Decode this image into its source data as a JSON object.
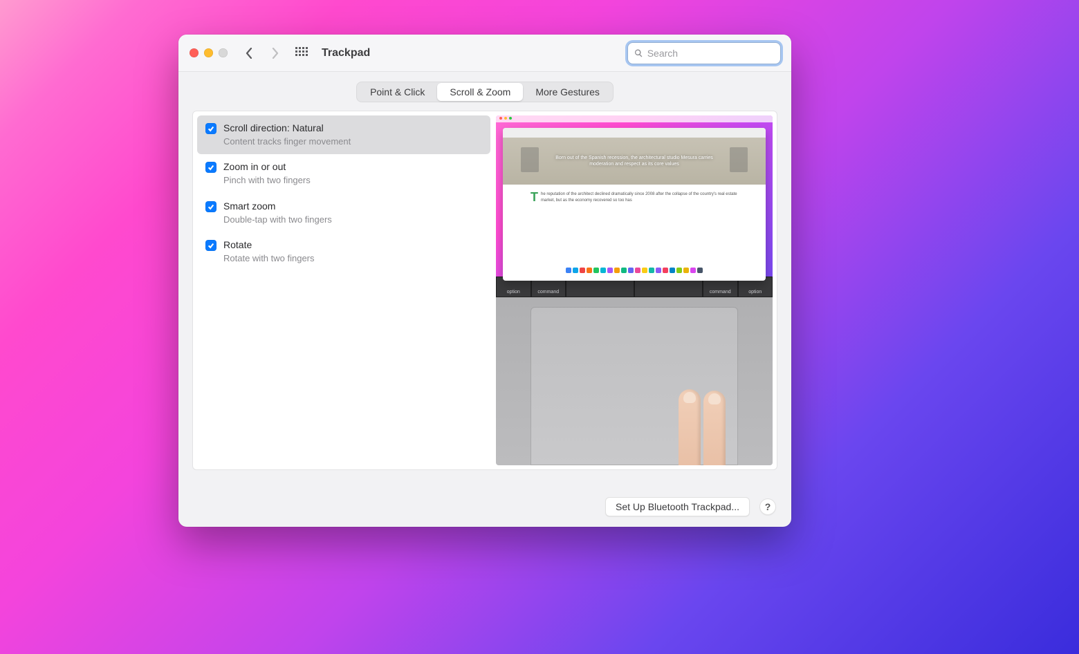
{
  "window": {
    "title": "Trackpad",
    "search_placeholder": "Search",
    "back_enabled": true,
    "forward_enabled": false
  },
  "tabs": [
    {
      "label": "Point & Click",
      "active": false
    },
    {
      "label": "Scroll & Zoom",
      "active": true
    },
    {
      "label": "More Gestures",
      "active": false
    }
  ],
  "options": [
    {
      "title": "Scroll direction: Natural",
      "subtitle": "Content tracks finger movement",
      "checked": true,
      "selected": true
    },
    {
      "title": "Zoom in or out",
      "subtitle": "Pinch with two fingers",
      "checked": true,
      "selected": false
    },
    {
      "title": "Smart zoom",
      "subtitle": "Double-tap with two fingers",
      "checked": true,
      "selected": false
    },
    {
      "title": "Rotate",
      "subtitle": "Rotate with two fingers",
      "checked": true,
      "selected": false
    }
  ],
  "preview": {
    "hero_text": "Born out of the Spanish recession, the architectural studio Mesura carries moderation and respect as its core values",
    "article_lead_letter": "T",
    "article_text": "he reputation of the architect declined dramatically since 2008 after the collapse of the country's real estate market, but as the economy recovered so too has",
    "touchbar_keys": [
      "option",
      "command",
      "",
      "",
      "command",
      "option"
    ]
  },
  "footer": {
    "bluetooth_button": "Set Up Bluetooth Trackpad...",
    "help": "?"
  },
  "colors": {
    "accent": "#0a7aff",
    "focus_ring": "#a7c6f1"
  }
}
